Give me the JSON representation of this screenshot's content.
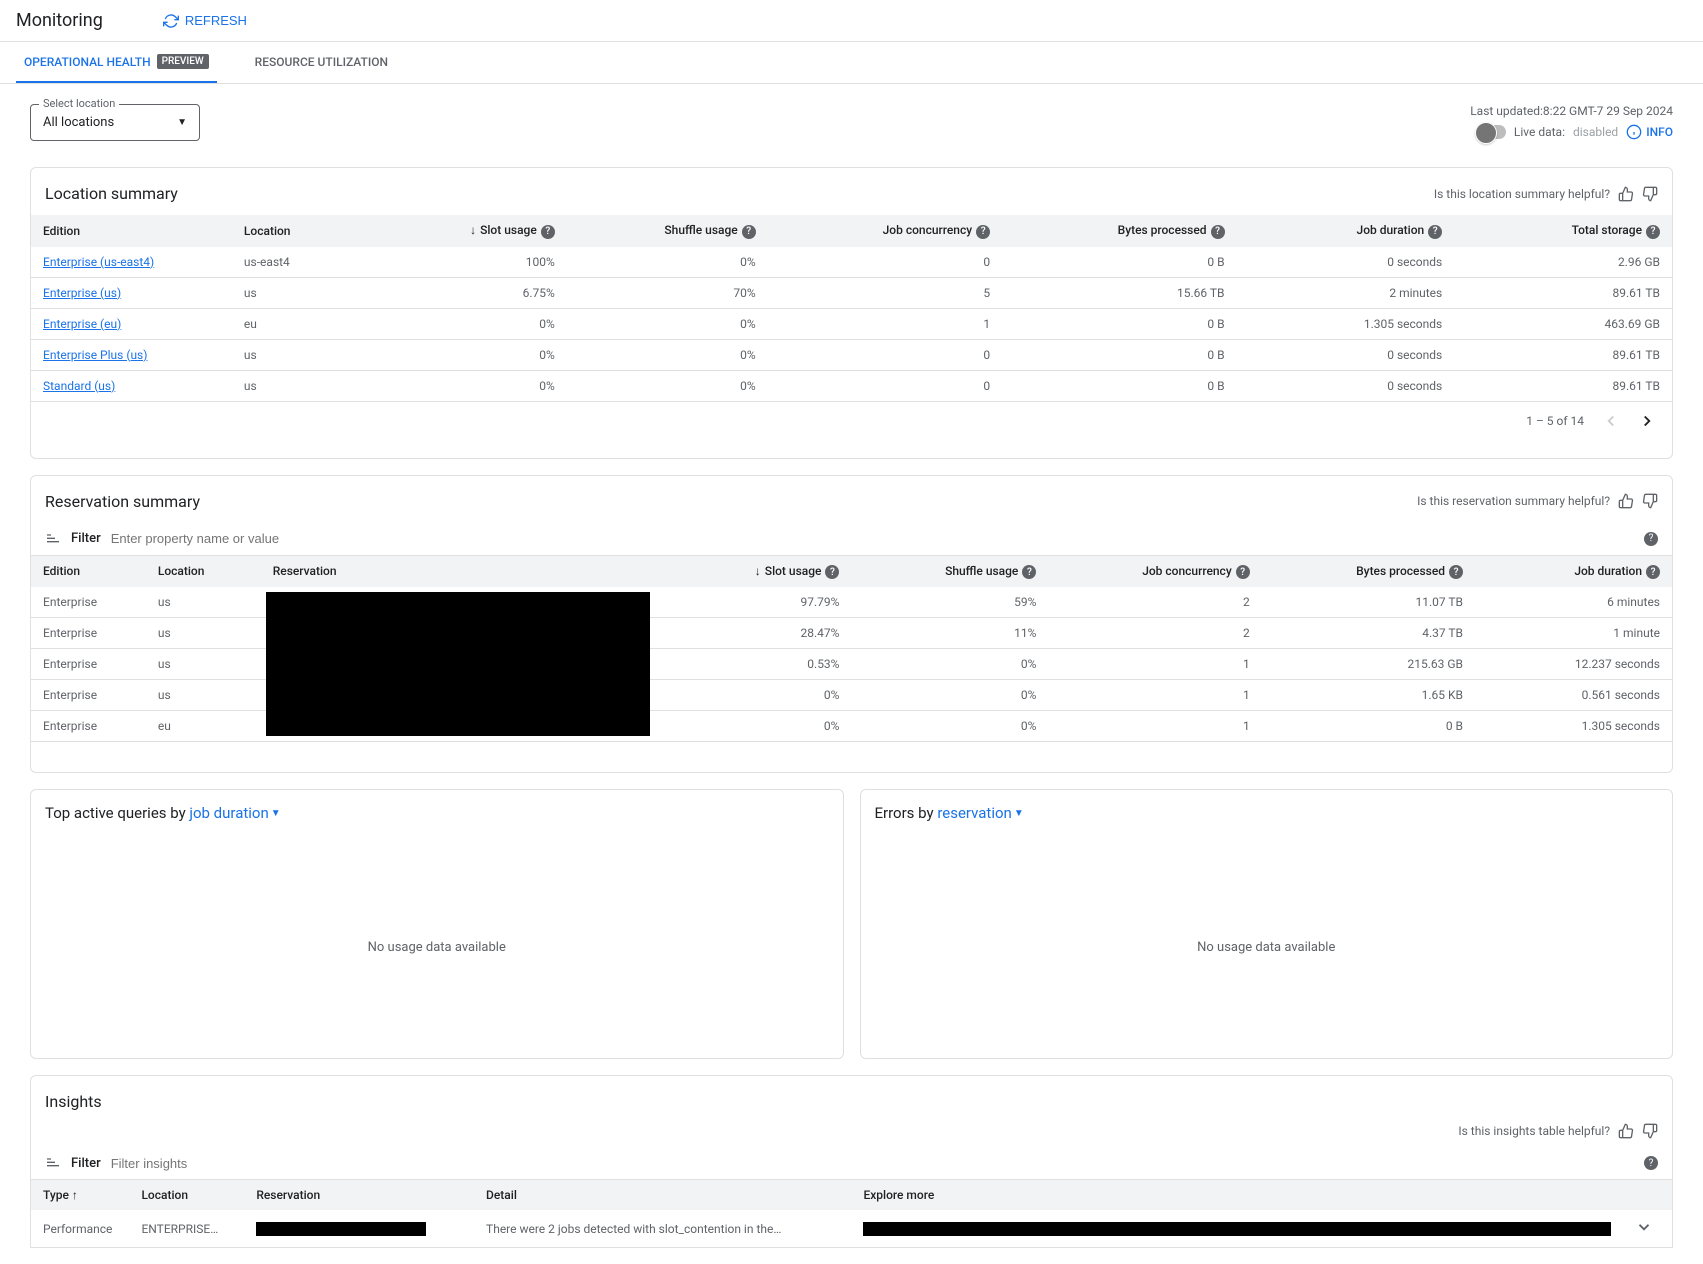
{
  "page_title": "Monitoring",
  "refresh_label": "REFRESH",
  "tabs": {
    "operational_health": "OPERATIONAL HEALTH",
    "preview_badge": "PREVIEW",
    "resource_utilization": "RESOURCE UTILIZATION"
  },
  "location_selector": {
    "label": "Select location",
    "value": "All locations"
  },
  "status": {
    "last_updated_label": "Last updated:",
    "last_updated_value": "8:22 GMT-7 29 Sep 2024",
    "live_data_label": "Live data:",
    "live_data_value": "disabled",
    "info_label": "INFO"
  },
  "location_summary": {
    "title": "Location summary",
    "helpful_prompt": "Is this location summary helpful?",
    "columns": {
      "edition": "Edition",
      "location": "Location",
      "slot_usage": "Slot usage",
      "shuffle_usage": "Shuffle usage",
      "job_concurrency": "Job concurrency",
      "bytes_processed": "Bytes processed",
      "job_duration": "Job duration",
      "total_storage": "Total storage"
    },
    "rows": [
      {
        "edition": "Enterprise (us-east4)",
        "location": "us-east4",
        "slot_usage": "100%",
        "shuffle_usage": "0%",
        "job_concurrency": "0",
        "bytes_processed": "0 B",
        "job_duration": "0 seconds",
        "total_storage": "2.96 GB"
      },
      {
        "edition": "Enterprise (us)",
        "location": "us",
        "slot_usage": "6.75%",
        "shuffle_usage": "70%",
        "job_concurrency": "5",
        "bytes_processed": "15.66 TB",
        "job_duration": "2 minutes",
        "total_storage": "89.61 TB"
      },
      {
        "edition": "Enterprise (eu)",
        "location": "eu",
        "slot_usage": "0%",
        "shuffle_usage": "0%",
        "job_concurrency": "1",
        "bytes_processed": "0 B",
        "job_duration": "1.305 seconds",
        "total_storage": "463.69 GB"
      },
      {
        "edition": "Enterprise Plus (us)",
        "location": "us",
        "slot_usage": "0%",
        "shuffle_usage": "0%",
        "job_concurrency": "0",
        "bytes_processed": "0 B",
        "job_duration": "0 seconds",
        "total_storage": "89.61 TB"
      },
      {
        "edition": "Standard (us)",
        "location": "us",
        "slot_usage": "0%",
        "shuffle_usage": "0%",
        "job_concurrency": "0",
        "bytes_processed": "0 B",
        "job_duration": "0 seconds",
        "total_storage": "89.61 TB"
      }
    ],
    "pager": "1 – 5 of 14"
  },
  "reservation_summary": {
    "title": "Reservation summary",
    "helpful_prompt": "Is this reservation summary helpful?",
    "filter_label": "Filter",
    "filter_placeholder": "Enter property name or value",
    "columns": {
      "edition": "Edition",
      "location": "Location",
      "reservation": "Reservation",
      "slot_usage": "Slot usage",
      "shuffle_usage": "Shuffle usage",
      "job_concurrency": "Job concurrency",
      "bytes_processed": "Bytes processed",
      "job_duration": "Job duration"
    },
    "rows": [
      {
        "edition": "Enterprise",
        "location": "us",
        "slot_usage": "97.79%",
        "shuffle_usage": "59%",
        "job_concurrency": "2",
        "bytes_processed": "11.07 TB",
        "job_duration": "6 minutes"
      },
      {
        "edition": "Enterprise",
        "location": "us",
        "slot_usage": "28.47%",
        "shuffle_usage": "11%",
        "job_concurrency": "2",
        "bytes_processed": "4.37 TB",
        "job_duration": "1 minute"
      },
      {
        "edition": "Enterprise",
        "location": "us",
        "slot_usage": "0.53%",
        "shuffle_usage": "0%",
        "job_concurrency": "1",
        "bytes_processed": "215.63 GB",
        "job_duration": "12.237 seconds"
      },
      {
        "edition": "Enterprise",
        "location": "us",
        "slot_usage": "0%",
        "shuffle_usage": "0%",
        "job_concurrency": "1",
        "bytes_processed": "1.65 KB",
        "job_duration": "0.561 seconds"
      },
      {
        "edition": "Enterprise",
        "location": "eu",
        "slot_usage": "0%",
        "shuffle_usage": "0%",
        "job_concurrency": "1",
        "bytes_processed": "0 B",
        "job_duration": "1.305 seconds"
      }
    ]
  },
  "top_queries": {
    "prefix": "Top active queries by ",
    "selector": "job duration",
    "no_data": "No usage data available"
  },
  "errors_by": {
    "prefix": "Errors by ",
    "selector": "reservation",
    "no_data": "No usage data available"
  },
  "insights": {
    "title": "Insights",
    "helpful_prompt": "Is this insights table helpful?",
    "filter_label": "Filter",
    "filter_placeholder": "Filter insights",
    "columns": {
      "type": "Type",
      "location": "Location",
      "reservation": "Reservation",
      "detail": "Detail",
      "explore_more": "Explore more"
    },
    "rows": [
      {
        "type": "Performance",
        "location": "ENTERPRISE…",
        "detail": "There were 2 jobs detected with slot_contention in the…"
      }
    ]
  }
}
